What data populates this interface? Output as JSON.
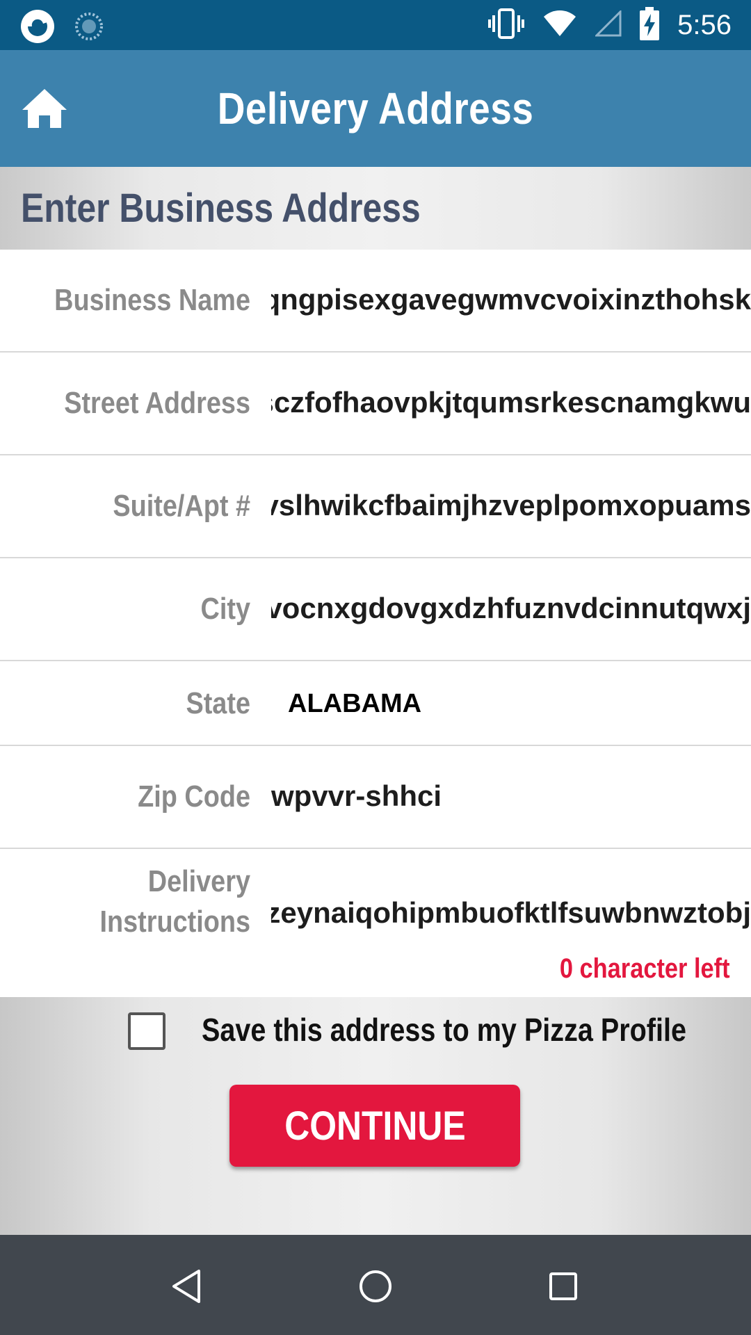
{
  "status_bar": {
    "time": "5:56",
    "icons": [
      "app-logo-icon",
      "loading-icon",
      "vibrate-icon",
      "wifi-icon",
      "signal-icon",
      "battery-charging-icon"
    ]
  },
  "app_bar": {
    "title": "Delivery Address",
    "home_icon": "home-icon"
  },
  "section": {
    "title": "Enter Business Address"
  },
  "form": {
    "business_name": {
      "label": "Business Name",
      "value": "cphgpqngpisexgavegwmvcvoixinzthohsk"
    },
    "street_address": {
      "label": "Street Address",
      "value": "bgkzrsczfofhaovpkjtqumsrkescnamgkwu"
    },
    "suite_apt": {
      "label": "Suite/Apt #",
      "value": "ıkwbhvslhwikcfbaimjhzveplpomxopuams"
    },
    "city": {
      "label": "City",
      "value": "pxivvcvocnxgdovgxdzhfuznvdcinnutqwxj"
    },
    "state": {
      "label": "State",
      "value": "ALABAMA"
    },
    "zip_code": {
      "label": "Zip Code",
      "value": "wpvvr-shhci"
    },
    "delivery_instructions": {
      "label_line1": "Delivery",
      "label_line2": "Instructions",
      "value": "zuyyflzeynaiqohipmbuofktlfsuwbnwztobj",
      "char_left": "0 character left"
    }
  },
  "save_profile": {
    "label": "Save this address to my Pizza Profile",
    "checked": false
  },
  "continue_button": {
    "label": "CONTINUE"
  },
  "colors": {
    "status_bar": "#0b5a85",
    "app_bar": "#3d82ad",
    "accent_red": "#e3173e",
    "label_gray": "#8a8a8a",
    "section_title": "#44506a",
    "nav_bar": "#41474e"
  },
  "nav_bar": {
    "icons": [
      "back-icon",
      "home-circle-icon",
      "recents-icon"
    ]
  }
}
